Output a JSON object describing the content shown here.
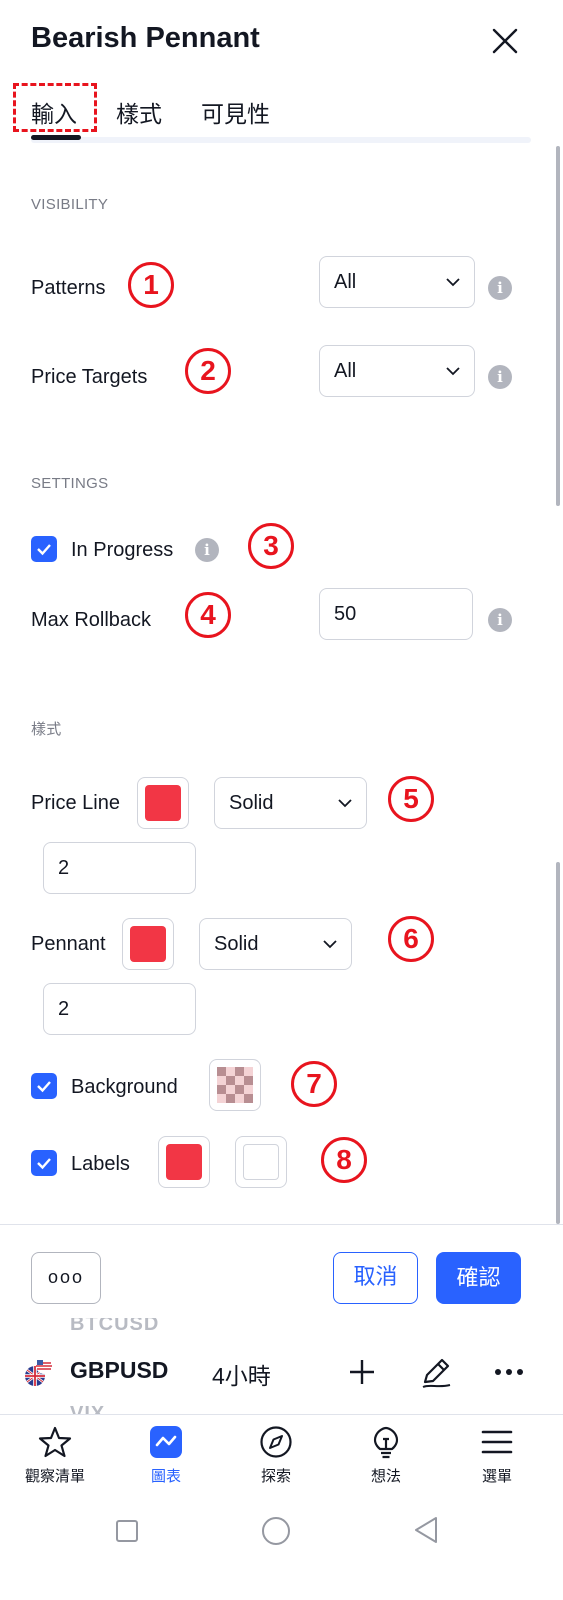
{
  "dialog": {
    "title": "Bearish Pennant",
    "tabs": [
      "輸入",
      "樣式",
      "可見性"
    ]
  },
  "visibility": {
    "heading": "VISIBILITY",
    "patterns": {
      "label": "Patterns",
      "value": "All",
      "badge": "1"
    },
    "price_targets": {
      "label": "Price Targets",
      "value": "All",
      "badge": "2"
    }
  },
  "settings": {
    "heading": "SETTINGS",
    "in_progress": {
      "label": "In Progress",
      "checked": true,
      "badge": "3"
    },
    "max_rollback": {
      "label": "Max Rollback",
      "value": "50",
      "badge": "4"
    }
  },
  "style": {
    "heading": "樣式",
    "price_line": {
      "label": "Price Line",
      "color": "#f23645",
      "line_style": "Solid",
      "width": "2",
      "badge": "5"
    },
    "pennant": {
      "label": "Pennant",
      "color": "#f23645",
      "line_style": "Solid",
      "width": "2",
      "badge": "6"
    },
    "background": {
      "label": "Background",
      "checked": true,
      "badge": "7"
    },
    "labels": {
      "label": "Labels",
      "checked": true,
      "color": "#f23645",
      "text_color": "#ffffff",
      "badge": "8"
    }
  },
  "footer": {
    "more": "ooo",
    "cancel": "取消",
    "ok": "確認"
  },
  "chart_bar": {
    "prev_symbol": "BTCUSD",
    "symbol": "GBPUSD",
    "next_symbol": "VIX",
    "interval": "4小時"
  },
  "bottom_nav": [
    {
      "label": "觀察清單",
      "icon": "star-icon"
    },
    {
      "label": "圖表",
      "icon": "chart-icon",
      "active": true
    },
    {
      "label": "探索",
      "icon": "compass-icon"
    },
    {
      "label": "想法",
      "icon": "lightbulb-icon"
    },
    {
      "label": "選單",
      "icon": "menu-icon"
    }
  ],
  "colors": {
    "accent": "#2962ff",
    "annotation_red": "#e8141e",
    "swatch_red": "#f23645"
  }
}
